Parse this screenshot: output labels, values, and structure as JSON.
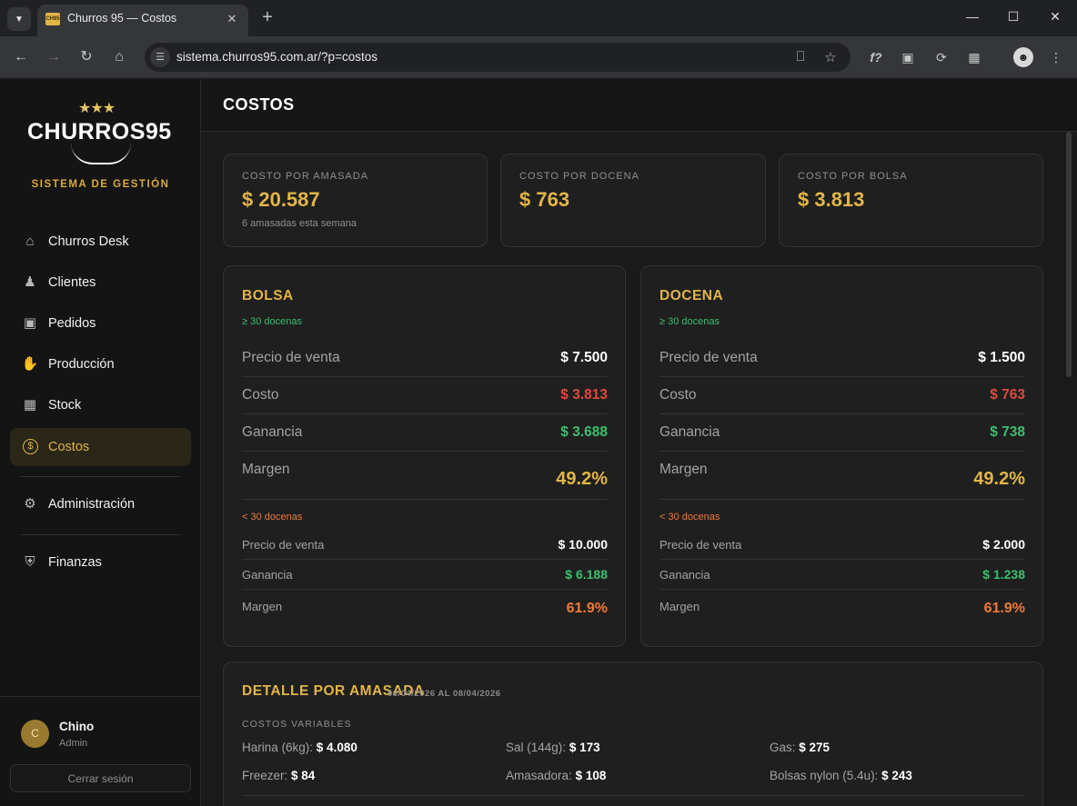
{
  "browser": {
    "tab_title": "Churros 95 — Costos",
    "favicon_text": "CH95",
    "url": "sistema.churros95.com.ar/?p=costos"
  },
  "brand": {
    "stars": "★★★",
    "name": "CHURROS95",
    "subtitle": "SISTEMA DE GESTIÓN",
    "accent": "#e2b547"
  },
  "sidebar": {
    "items": [
      {
        "label": "Churros Desk",
        "icon": "house-user-icon"
      },
      {
        "label": "Clientes",
        "icon": "user-check-icon"
      },
      {
        "label": "Pedidos",
        "icon": "store-icon"
      },
      {
        "label": "Producción",
        "icon": "hand-dough-icon"
      },
      {
        "label": "Stock",
        "icon": "warehouse-icon"
      },
      {
        "label": "Costos",
        "icon": "dollar-circle-icon",
        "active": true
      },
      {
        "label": "Administración",
        "icon": "gear-icon"
      },
      {
        "label": "Finanzas",
        "icon": "bank-icon"
      }
    ],
    "user": {
      "initial": "C",
      "name": "Chino",
      "role": "Admin"
    },
    "logout_label": "Cerrar sesión"
  },
  "main": {
    "title": "COSTOS",
    "kpis": [
      {
        "label": "COSTO POR AMASADA",
        "value": "$ 20.587",
        "note": "6 amasadas esta semana"
      },
      {
        "label": "COSTO POR DOCENA",
        "value": "$ 763"
      },
      {
        "label": "COSTO POR BOLSA",
        "value": "$ 3.813"
      }
    ],
    "pricing": [
      {
        "title": "BOLSA",
        "tier_high": "≥ 30 docenas",
        "rows": [
          {
            "label": "Precio de venta",
            "value": "$ 7.500"
          },
          {
            "label": "Costo",
            "value": "$ 3.813"
          },
          {
            "label": "Ganancia",
            "value": "$ 3.688"
          },
          {
            "label": "Margen",
            "value": "49.2%"
          }
        ],
        "tier_low": "< 30 docenas",
        "low_rows": [
          {
            "label": "Precio de venta",
            "value": "$ 10.000"
          },
          {
            "label": "Ganancia",
            "value": "$ 6.188"
          },
          {
            "label": "Margen",
            "value": "61.9%"
          }
        ]
      },
      {
        "title": "DOCENA",
        "tier_high": "≥ 30 docenas",
        "rows": [
          {
            "label": "Precio de venta",
            "value": "$ 1.500"
          },
          {
            "label": "Costo",
            "value": "$ 763"
          },
          {
            "label": "Ganancia",
            "value": "$ 738"
          },
          {
            "label": "Margen",
            "value": "49.2%"
          }
        ],
        "tier_low": "< 30 docenas",
        "low_rows": [
          {
            "label": "Precio de venta",
            "value": "$ 2.000"
          },
          {
            "label": "Ganancia",
            "value": "$ 1.238"
          },
          {
            "label": "Margen",
            "value": "61.9%"
          }
        ]
      }
    ],
    "detail": {
      "title": "DETALLE POR AMASADA",
      "range": "06/04/2026 AL 08/04/2026",
      "section": "COSTOS VARIABLES",
      "items": [
        {
          "label": "Harina (6kg):",
          "value": "$ 4.080"
        },
        {
          "label": "Sal (144g):",
          "value": "$ 173"
        },
        {
          "label": "Gas:",
          "value": "$ 275"
        },
        {
          "label": "Freezer:",
          "value": "$ 84"
        },
        {
          "label": "Amasadora:",
          "value": "$ 108"
        },
        {
          "label": "Bolsas nylon (5.4u):",
          "value": "$ 243"
        }
      ]
    }
  }
}
